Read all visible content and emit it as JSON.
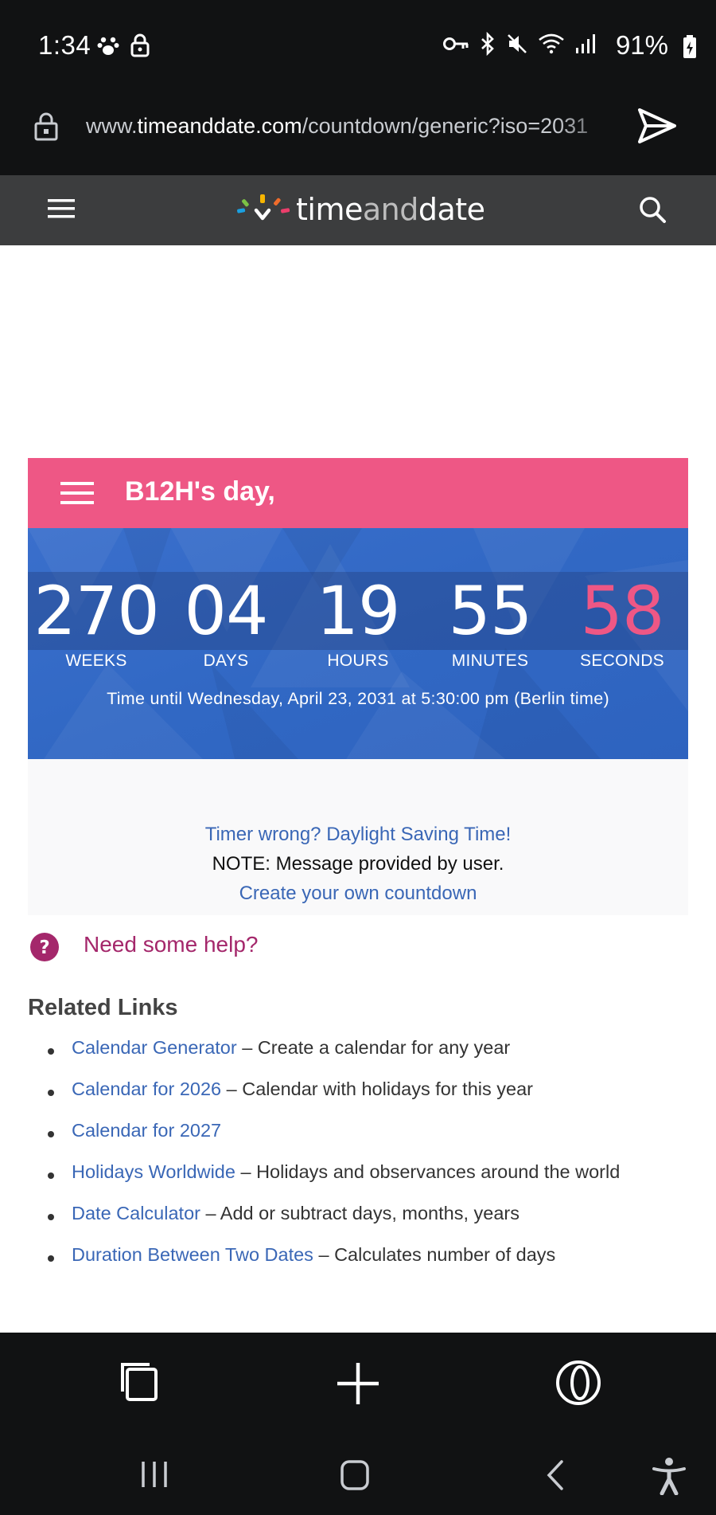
{
  "status_bar": {
    "time": "1:34",
    "battery": "91%",
    "left_icons": [
      "paw-icon",
      "lock-icon"
    ],
    "right_icons": [
      "key-icon",
      "bluetooth-icon",
      "mute-icon",
      "wifi-icon",
      "signal-icon"
    ]
  },
  "url_bar": {
    "prefix": "www.",
    "domain": "timeanddate.com",
    "path": "/countdown/generic?iso=2031"
  },
  "site": {
    "logo_time": "time",
    "logo_and": "and",
    "logo_date": "date"
  },
  "countdown": {
    "title": "B12H's day,",
    "units": [
      {
        "value": "270",
        "label": "WEEKS"
      },
      {
        "value": "04",
        "label": "DAYS"
      },
      {
        "value": "19",
        "label": "HOURS"
      },
      {
        "value": "55",
        "label": "MINUTES"
      },
      {
        "value": "58",
        "label": "SECONDS"
      }
    ],
    "until": "Time until Wednesday, April 23, 2031 at 5:30:00 pm (Berlin time)",
    "accent_color": "#ee5785",
    "panel_color": "#3168c4"
  },
  "notes": {
    "dst_link": "Timer wrong? Daylight Saving Time!",
    "note": "NOTE: Message provided by user.",
    "create_link": "Create your own countdown"
  },
  "help": {
    "label": "Need some help?"
  },
  "related": {
    "title": "Related Links",
    "items": [
      {
        "link": "Calendar Generator",
        "desc": " – Create a calendar for any year"
      },
      {
        "link": "Calendar for 2026",
        "desc": " – Calendar with holidays for this year"
      },
      {
        "link": "Calendar for 2027",
        "desc": ""
      },
      {
        "link": "Holidays Worldwide",
        "desc": " – Holidays and observances around the world"
      },
      {
        "link": "Date Calculator",
        "desc": " – Add or subtract days, months, years"
      },
      {
        "link": "Duration Between Two Dates",
        "desc": " – Calculates number of days"
      }
    ]
  },
  "browser_toolbar": {
    "icons": [
      "tabs-icon",
      "plus-icon",
      "opera-icon"
    ]
  },
  "nav_bar": {
    "icons": [
      "recents-icon",
      "home-icon",
      "back-icon",
      "accessibility-icon"
    ]
  }
}
